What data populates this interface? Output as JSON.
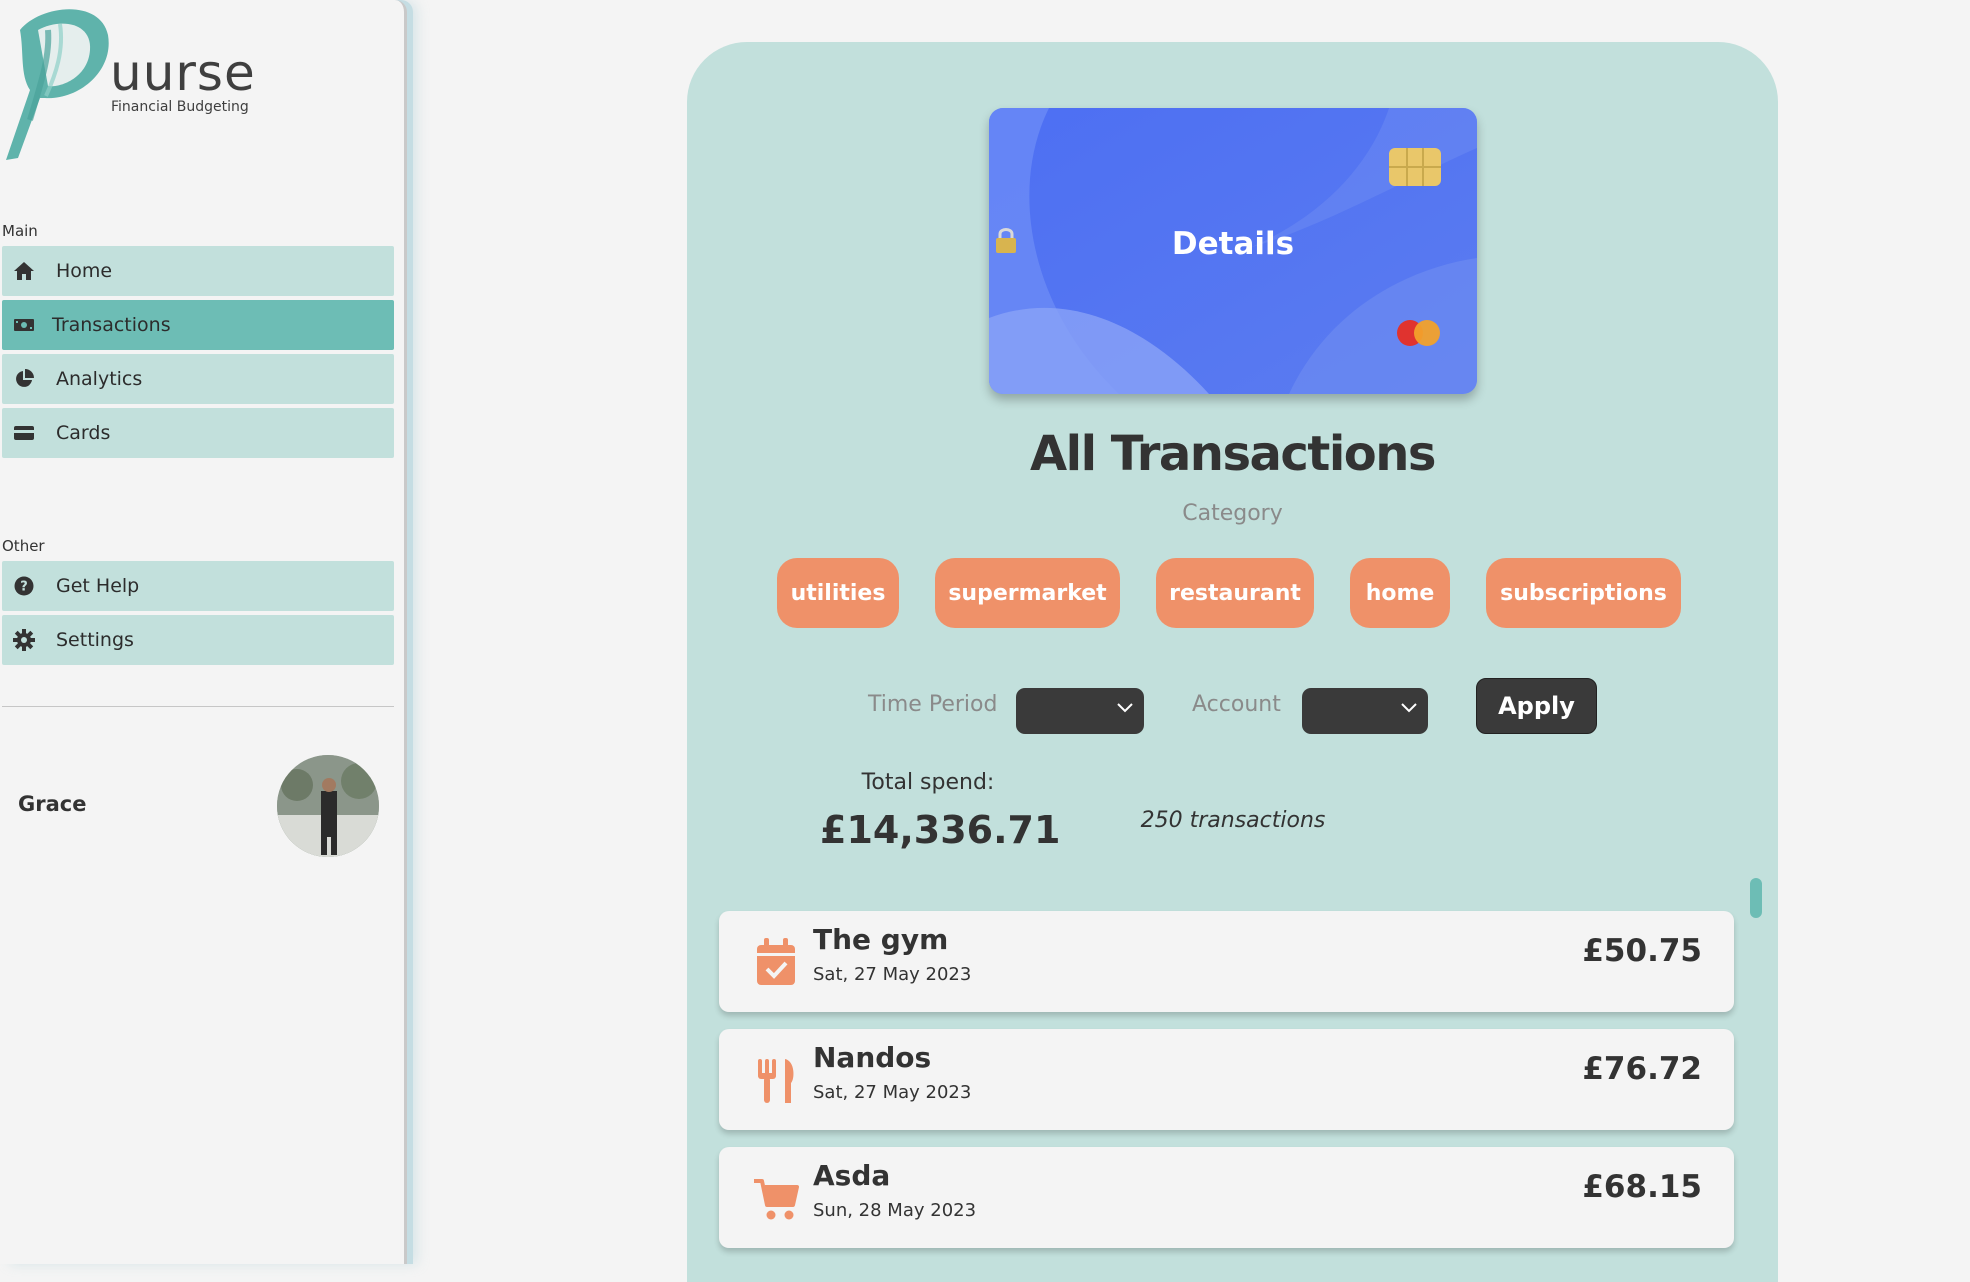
{
  "brand": {
    "logo_letter": "P",
    "name": "uurse",
    "tagline": "Financial Budgeting",
    "accent": "#5fb3ab"
  },
  "sidebar": {
    "main_label": "Main",
    "main_items": [
      {
        "label": "Home",
        "icon": "home-icon"
      },
      {
        "label": "Transactions",
        "icon": "money-icon",
        "active": true
      },
      {
        "label": "Analytics",
        "icon": "pie-chart-icon"
      },
      {
        "label": "Cards",
        "icon": "credit-card-icon"
      }
    ],
    "other_label": "Other",
    "other_items": [
      {
        "label": "Get Help",
        "icon": "help-icon"
      },
      {
        "label": "Settings",
        "icon": "gear-icon"
      }
    ],
    "user": {
      "name": "Grace"
    }
  },
  "card": {
    "label": "Details",
    "lock_icon": "lock-icon"
  },
  "main": {
    "title": "All Transactions",
    "category_label": "Category",
    "categories": [
      "utilities",
      "supermarket",
      "restaurant",
      "home",
      "subscriptions"
    ],
    "filters": {
      "time_period_label": "Time Period",
      "account_label": "Account",
      "apply_label": "Apply"
    },
    "summary": {
      "total_label": "Total spend:",
      "total_value": "£14,336.71",
      "count_text": "250 transactions"
    },
    "transactions": [
      {
        "name": "The gym",
        "date": "Sat, 27 May 2023",
        "amount": "£50.75",
        "icon": "calendar-check-icon"
      },
      {
        "name": "Nandos",
        "date": "Sat, 27 May 2023",
        "amount": "£76.72",
        "icon": "utensils-icon"
      },
      {
        "name": "Asda",
        "date": "Sun, 28 May 2023",
        "amount": "£68.15",
        "icon": "shopping-cart-icon"
      }
    ]
  },
  "colors": {
    "panel": "#c2e0dc",
    "chip": "#ef9169",
    "active_nav": "#6dbdb5",
    "dark_button": "#3a3a3a"
  }
}
